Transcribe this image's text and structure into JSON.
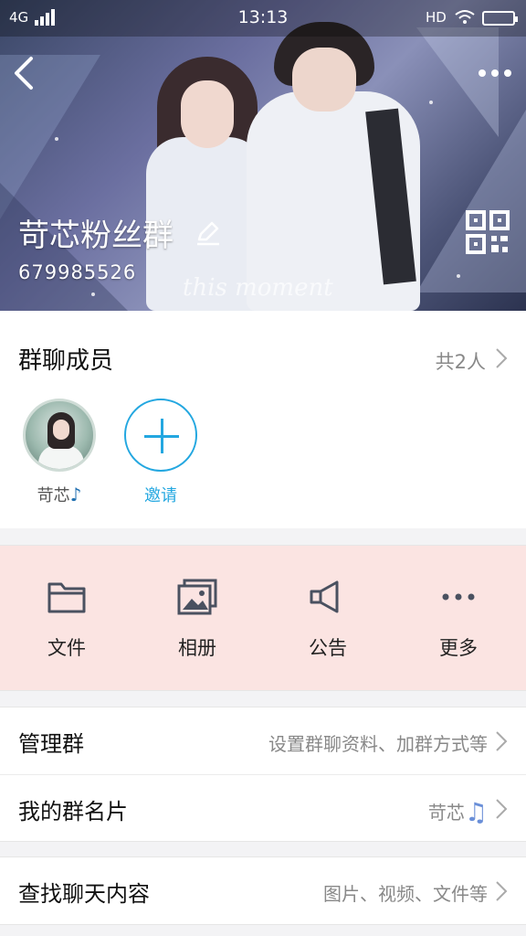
{
  "status_bar": {
    "network": "4G",
    "time": "13:13",
    "hd": "HD"
  },
  "header": {
    "group_name": "苛芯粉丝群",
    "group_id": "679985526",
    "banner_script": "this moment"
  },
  "members": {
    "title": "群聊成员",
    "count": "共2人",
    "list": [
      {
        "name": "苛芯",
        "note": "♪"
      }
    ],
    "invite_label": "邀请"
  },
  "tools": [
    {
      "label": "文件",
      "icon": "folder-icon"
    },
    {
      "label": "相册",
      "icon": "album-icon"
    },
    {
      "label": "公告",
      "icon": "announcement-icon"
    },
    {
      "label": "更多",
      "icon": "more-dots-icon"
    }
  ],
  "rows_group1": [
    {
      "label": "管理群",
      "value": "设置群聊资料、加群方式等"
    },
    {
      "label": "我的群名片",
      "value": "苛芯",
      "value_suffix": "♫"
    }
  ],
  "rows_group2": [
    {
      "label": "查找聊天内容",
      "value": "图片、视频、文件等"
    }
  ],
  "colors": {
    "accent": "#23a7e0",
    "tools_bg": "#fbe4e2",
    "icon_gray": "#4a5160"
  }
}
